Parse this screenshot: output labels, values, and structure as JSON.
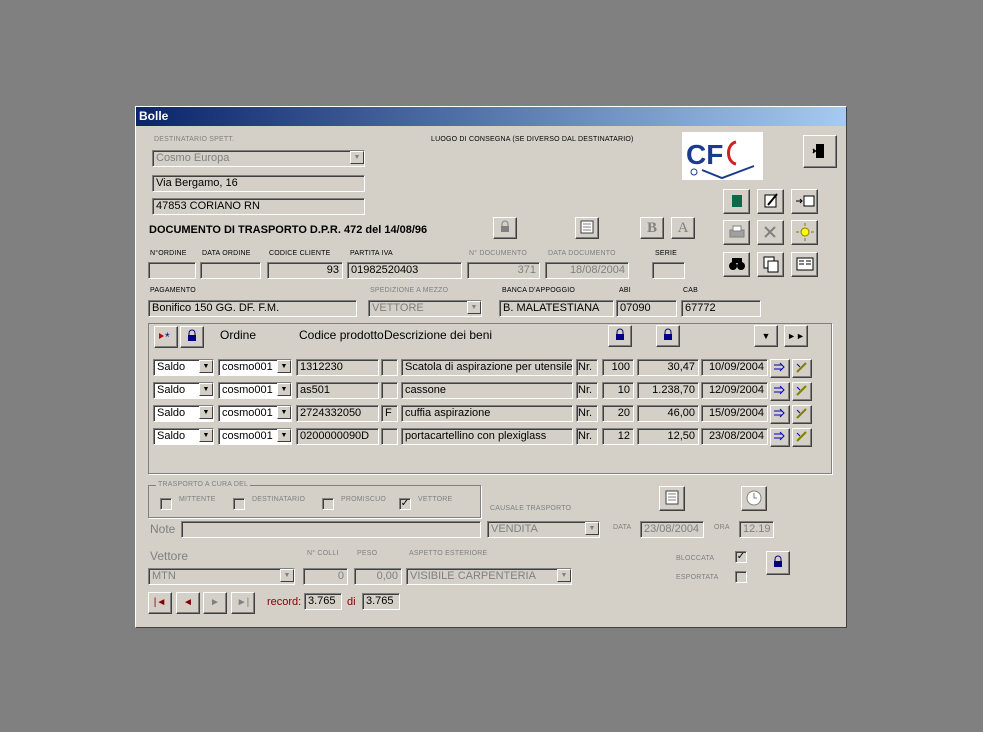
{
  "window": {
    "title": "Bolle"
  },
  "destinatario": {
    "label": "DESTINATARIO SPETT.",
    "name": "Cosmo Europa",
    "address": "Via Bergamo, 16",
    "city": "47853 CORIANO RN"
  },
  "luogo_label": "LUOGO DI CONSEGNA (SE DIVERSO DAL DESTINATARIO)",
  "logo_text": "CF",
  "doc_title": "DOCUMENTO DI TRASPORTO D.P.R. 472 del 14/08/96",
  "labels": {
    "n_ordine": "N°ORDINE",
    "data_ordine": "DATA ORDINE",
    "codice_cliente": "CODICE CLIENTE",
    "partita_iva": "PARTITA IVA",
    "n_documento": "N° DOCUMENTO",
    "data_documento": "DATA DOCUMENTO",
    "serie": "SERIE",
    "pagamento": "PAGAMENTO",
    "spedizione": "SPEDIZIONE A MEZZO",
    "banca": "BANCA D'APPOGGIO",
    "abi": "ABI",
    "cab": "CAB"
  },
  "values": {
    "n_ordine": "",
    "data_ordine": "",
    "codice_cliente": "93",
    "partita_iva": "01982520403",
    "n_documento": "371",
    "data_documento": "18/08/2004",
    "serie": "",
    "pagamento": "Bonifico 150 GG. DF. F.M.",
    "spedizione": "VETTORE",
    "banca": "B. MALATESTIANA",
    "abi": "07090",
    "cab": "67772"
  },
  "grid": {
    "col_ordine": "Ordine",
    "col_codice": "Codice prodotto",
    "col_descrizione": "Descrizione dei beni",
    "rows": [
      {
        "tipo": "Saldo",
        "ordine": "cosmo001",
        "codice": "1312230",
        "flag": "",
        "descr": "Scatola di aspirazione per utensile c",
        "um": "Nr.",
        "qta": "100",
        "prezzo": "30,47",
        "data": "10/09/2004"
      },
      {
        "tipo": "Saldo",
        "ordine": "cosmo001",
        "codice": "as501",
        "flag": "",
        "descr": "cassone",
        "um": "Nr.",
        "qta": "10",
        "prezzo": "1.238,70",
        "data": "12/09/2004"
      },
      {
        "tipo": "Saldo",
        "ordine": "cosmo001",
        "codice": "2724332050",
        "flag": "F",
        "descr": "cuffia aspirazione",
        "um": "Nr.",
        "qta": "20",
        "prezzo": "46,00",
        "data": "15/09/2004"
      },
      {
        "tipo": "Saldo",
        "ordine": "cosmo001",
        "codice": "0200000090D",
        "flag": "",
        "descr": "portacartellino con plexiglass",
        "um": "Nr.",
        "qta": "12",
        "prezzo": "12,50",
        "data": "23/08/2004"
      }
    ]
  },
  "trasporto": {
    "label": "TRASPORTO A CURA DEL",
    "mittente": "MITTENTE",
    "destinatario": "DESTINATARIO",
    "promiscuo": "PROMISCUO",
    "vettore": "VETTORE",
    "vettore_checked": true
  },
  "causale": {
    "label": "CAUSALE TRASPORTO",
    "value": "VENDITA"
  },
  "note": {
    "label": "Note",
    "value": ""
  },
  "data_label": "DATA",
  "data_value": "23/08/2004",
  "ora_label": "ORA",
  "ora_value": "12.19",
  "vettore": {
    "label": "Vettore",
    "value": "MTN",
    "ncolli_label": "N° COLLI",
    "ncolli": "0",
    "peso_label": "PESO",
    "peso": "0,00",
    "aspetto_label": "ASPETTO ESTERIORE",
    "aspetto": "VISIBILE CARPENTERIA"
  },
  "bloccata": {
    "label": "BLOCCATA",
    "checked": true
  },
  "esportata": {
    "label": "ESPORTATA",
    "checked": false
  },
  "nav": {
    "record_label": "record:",
    "current": "3.765",
    "di_label": "di",
    "total": "3.765"
  },
  "colors": {
    "title_start": "#0a246a",
    "title_end": "#a6caf0",
    "face": "#d4d0c8",
    "desktop": "#808080",
    "record_red": "#800000"
  }
}
